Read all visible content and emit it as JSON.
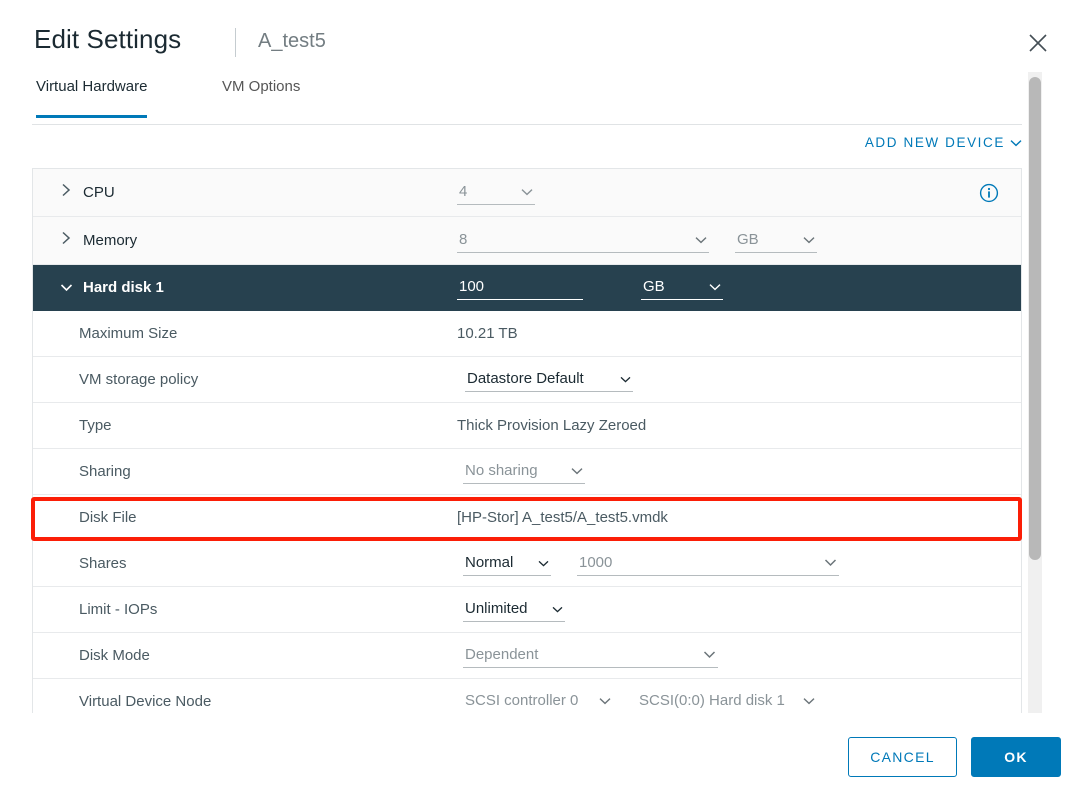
{
  "header": {
    "title": "Edit Settings",
    "subject": "A_test5",
    "close_icon": "close-icon"
  },
  "tabs": [
    {
      "label": "Virtual Hardware",
      "active": true
    },
    {
      "label": "VM Options",
      "active": false
    }
  ],
  "toolbar": {
    "add_new_device_label": "ADD NEW DEVICE",
    "add_new_device_chevron": "chevron-down-icon"
  },
  "hardware": {
    "cpu": {
      "label": "CPU",
      "value": "4",
      "expanded": false,
      "info_icon": "info-icon"
    },
    "memory": {
      "label": "Memory",
      "value": "8",
      "unit": "GB",
      "expanded": false
    },
    "hard_disk": {
      "label": "Hard disk 1",
      "value": "100",
      "unit": "GB",
      "expanded": true,
      "selected": true
    }
  },
  "disk_details": [
    {
      "label": "Maximum Size",
      "value": "10.21 TB",
      "kind": "static"
    },
    {
      "label": "VM storage policy",
      "value": "Datastore Default",
      "kind": "select-strong"
    },
    {
      "label": "Type",
      "value": "Thick Provision Lazy Zeroed",
      "kind": "static"
    },
    {
      "label": "Sharing",
      "value": "No sharing",
      "kind": "select"
    },
    {
      "label": "Disk File",
      "value": "[HP-Stor] A_test5/A_test5.vmdk",
      "kind": "static",
      "highlighted": true
    },
    {
      "label": "Shares",
      "value": "Normal",
      "value2": "1000",
      "kind": "select-strong-plus-field"
    },
    {
      "label": "Limit - IOPs",
      "value": "Unlimited",
      "kind": "select-strong"
    },
    {
      "label": "Disk Mode",
      "value": "Dependent",
      "kind": "select-wide"
    },
    {
      "label": "Virtual Device Node",
      "value": "SCSI controller 0",
      "value2": "SCSI(0:0) Hard disk 1",
      "kind": "select-pair",
      "clipped": true
    }
  ],
  "footer": {
    "cancel_label": "CANCEL",
    "ok_label": "OK"
  },
  "colors": {
    "accent": "#0079b8",
    "selected_row": "#27414f",
    "highlight_box": "#fb1e07",
    "text_primary": "#1b2a32",
    "text_secondary": "#8a9398"
  }
}
